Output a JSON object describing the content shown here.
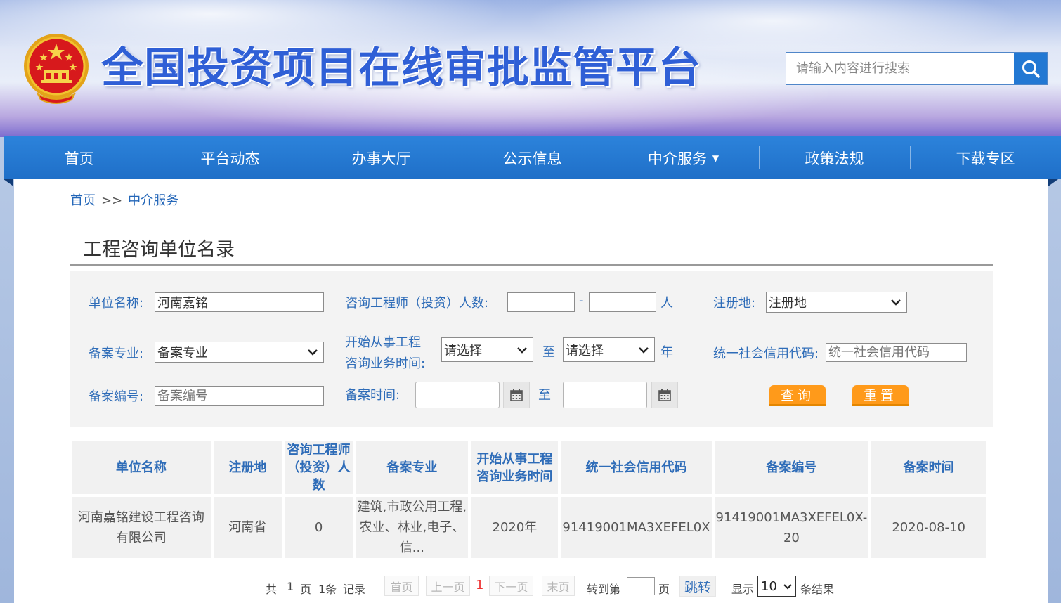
{
  "header": {
    "site_title": "全国投资项目在线审批监管平台",
    "search_placeholder": "请输入内容进行搜索",
    "emblem_icon": "national-emblem-icon",
    "search_icon": "search-icon"
  },
  "nav": {
    "items": [
      {
        "label": "首页"
      },
      {
        "label": "平台动态"
      },
      {
        "label": "办事大厅"
      },
      {
        "label": "公示信息"
      },
      {
        "label": "中介服务",
        "caret": "▼"
      },
      {
        "label": "政策法规"
      },
      {
        "label": "下载专区"
      }
    ]
  },
  "breadcrumb": {
    "home": "首页",
    "sep": ">>",
    "current": "中介服务"
  },
  "page_title": "工程咨询单位名录",
  "filter": {
    "unit_name_label": "单位名称:",
    "unit_name_value": "河南嘉铭",
    "engineer_count_label": "咨询工程师（投资）人数:",
    "range_dash": "-",
    "person_unit": "人",
    "reg_place_label": "注册地:",
    "reg_place_value": "注册地",
    "specialty_label": "备案专业:",
    "specialty_value": "备案专业",
    "start_time_label_1": "开始从事工程",
    "start_time_label_2": "咨询业务时间:",
    "select_placeholder": "请选择",
    "to": "至",
    "year_unit": "年",
    "credit_code_label": "统一社会信用代码:",
    "credit_code_placeholder": "统一社会信用代码",
    "record_no_label": "备案编号:",
    "record_no_placeholder": "备案编号",
    "record_time_label": "备案时间:",
    "query_button": "查询",
    "reset_button": "重置"
  },
  "table": {
    "headers": [
      "单位名称",
      "注册地",
      "咨询工程师（投资）人数",
      "备案专业",
      "开始从事工程咨询业务时间",
      "统一社会信用代码",
      "备案编号",
      "备案时间"
    ],
    "rows": [
      [
        "河南嘉铭建设工程咨询有限公司",
        "河南省",
        "0",
        "建筑,市政公用工程,农业、林业,电子、信...",
        "2020年",
        "91419001MA3XEFEL0X",
        "91419001MA3XEFEL0X-20",
        "2020-08-10"
      ]
    ]
  },
  "pager": {
    "total_prefix": "共",
    "total_pages": "1",
    "page_unit": "页",
    "total_records": "1条",
    "record_unit": "记录",
    "first": "首页",
    "prev": "上一页",
    "current": "1",
    "next": "下一页",
    "last": "末页",
    "goto_label": "转到第",
    "goto_unit": "页",
    "jump_button": "跳转",
    "show_label": "显示",
    "page_size": "10",
    "result_unit": "条结果"
  }
}
